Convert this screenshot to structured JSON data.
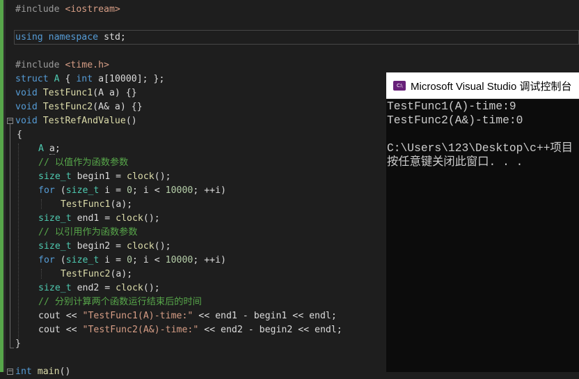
{
  "editor": {
    "lines": {
      "l1": {
        "prefix": "#include ",
        "header": "<iostream>"
      },
      "l2": {
        "kw1": "using",
        "kw2": "namespace",
        "rest": " std;"
      },
      "l3": {
        "prefix": "#include ",
        "header": "<time.h>"
      },
      "l4": {
        "kw": "struct",
        "name": " A ",
        "rest1": "{ ",
        "type": "int",
        "rest2": " a[10000]; };"
      },
      "l5": {
        "kw": "void",
        "fn": " TestFunc1",
        "rest": "(A a) {}"
      },
      "l6": {
        "kw": "void",
        "fn": " TestFunc2",
        "rest": "(A& a) {}"
      },
      "l7": {
        "kw": "void",
        "fn": " TestRefAndValue",
        "rest": "()"
      },
      "l8": {
        "text": "{"
      },
      "l9": {
        "type": "A",
        "rest1": " ",
        "var": "a",
        "rest2": ";"
      },
      "l10": {
        "comment": "// 以值作为函数参数"
      },
      "l11": {
        "type": "size_t",
        "rest1": " begin1 = ",
        "fn": "clock",
        "rest2": "();"
      },
      "l12": {
        "kw": "for",
        "rest1": " (",
        "type": "size_t",
        "rest2": " i = ",
        "n1": "0",
        "rest3": "; i < ",
        "n2": "10000",
        "rest4": "; ++i)"
      },
      "l13": {
        "fn": "TestFunc1",
        "rest": "(a);"
      },
      "l14": {
        "type": "size_t",
        "rest1": " end1 = ",
        "fn": "clock",
        "rest2": "();"
      },
      "l15": {
        "comment": "// 以引用作为函数参数"
      },
      "l16": {
        "type": "size_t",
        "rest1": " begin2 = ",
        "fn": "clock",
        "rest2": "();"
      },
      "l17": {
        "kw": "for",
        "rest1": " (",
        "type": "size_t",
        "rest2": " i = ",
        "n1": "0",
        "rest3": "; i < ",
        "n2": "10000",
        "rest4": "; ++i)"
      },
      "l18": {
        "fn": "TestFunc2",
        "rest": "(a);"
      },
      "l19": {
        "type": "size_t",
        "rest1": " end2 = ",
        "fn": "clock",
        "rest2": "();"
      },
      "l20": {
        "comment": "// 分别计算两个函数运行结束后的时间"
      },
      "l21": {
        "v1": "cout",
        "o1": " << ",
        "str": "\"TestFunc1(A)-time:\"",
        "o2": " << ",
        "v2": "end1",
        "o3": " - ",
        "v3": "begin1",
        "o4": " << ",
        "v4": "endl",
        "end": ";"
      },
      "l22": {
        "v1": "cout",
        "o1": " << ",
        "str": "\"TestFunc2(A&)-time:\"",
        "o2": " << ",
        "v2": "end2",
        "o3": " - ",
        "v3": "begin2",
        "o4": " << ",
        "v4": "endl",
        "end": ";"
      },
      "l23": {
        "text": "}"
      },
      "l24": {
        "type": "int",
        "fn": " main",
        "rest": "()"
      }
    },
    "colors": {
      "background": "#1e1e1e",
      "keyword": "#569cd6",
      "type": "#4ec9b0",
      "string": "#d69d85",
      "comment": "#57a64a",
      "function": "#dcdcaa",
      "change_bar": "#57a64a"
    }
  },
  "console": {
    "title": "Microsoft Visual Studio 调试控制台",
    "icon_text": "C:\\",
    "output": [
      "TestFunc1(A)-time:9",
      "TestFunc2(A&)-time:0",
      "",
      "C:\\Users\\123\\Desktop\\c++项目",
      "按任意键关闭此窗口. . ."
    ],
    "colors": {
      "background": "#0c0c0c",
      "text": "#cccccc",
      "titlebar": "#ffffff",
      "icon": "#68217a"
    }
  }
}
